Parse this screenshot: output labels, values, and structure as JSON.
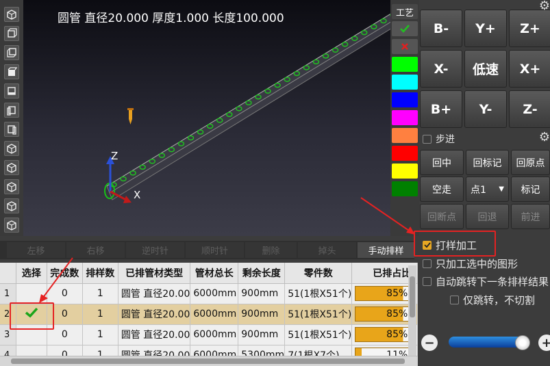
{
  "viewport": {
    "title": "圆管 直径20.000 厚度1.000 长度100.000",
    "axis_z": "Z",
    "axis_x": "X"
  },
  "craft": {
    "label": "工艺",
    "check_icon": "check-icon",
    "cross_icon": "cross-icon",
    "colors": [
      "#00ff00",
      "#00ffff",
      "#0000ff",
      "#ff00ff",
      "#ff8040",
      "#ff0000",
      "#ffff00",
      "#008000"
    ]
  },
  "dirpad": {
    "b_minus": "B-",
    "y_plus": "Y+",
    "z_plus": "Z+",
    "x_minus": "X-",
    "low_speed": "低速",
    "x_plus": "X+",
    "b_plus": "B+",
    "y_minus": "Y-",
    "z_minus": "Z-"
  },
  "step": {
    "label": "步进"
  },
  "actions": {
    "center": "回中",
    "return_mark": "回标记",
    "return_origin": "回原点",
    "dry_run": "空走",
    "point_select": "点1",
    "mark": "标记",
    "return_break": "回断点",
    "back": "回退",
    "forward": "前进"
  },
  "options": {
    "proof": "打样加工",
    "only_selected": "只加工选中的图形",
    "auto_jump": "自动跳转下一条排样结果",
    "jump_only": "仅跳转，不切割"
  },
  "tabs": [
    "左移",
    "右移",
    "逆时针",
    "顺时针",
    "删除",
    "掉头",
    "手动排样"
  ],
  "table": {
    "headers": [
      "选择",
      "完成数",
      "排样数",
      "已排管材类型",
      "管材总长",
      "剩余长度",
      "零件数",
      "已排占比"
    ],
    "rows": [
      {
        "idx": "1",
        "done": "0",
        "count": "1",
        "type": "圆管 直径20.00",
        "total": "6000mm",
        "remain": "900mm",
        "parts": "51(1根X51个)",
        "ratio": "85%"
      },
      {
        "idx": "2",
        "done": "0",
        "count": "1",
        "type": "圆管 直径20.00",
        "total": "6000mm",
        "remain": "900mm",
        "parts": "51(1根X51个)",
        "ratio": "85%"
      },
      {
        "idx": "3",
        "done": "0",
        "count": "1",
        "type": "圆管 直径20.00",
        "total": "6000mm",
        "remain": "900mm",
        "parts": "51(1根X51个)",
        "ratio": "85%"
      },
      {
        "idx": "4",
        "done": "0",
        "count": "1",
        "type": "圆管 直径20.00",
        "total": "6000mm",
        "remain": "5300mm",
        "parts": "7(1根X7个)",
        "ratio": "11%"
      }
    ]
  },
  "progress": {
    "row1": 0.85,
    "row2": 0.85,
    "row3": 0.85,
    "row4": 0.11
  },
  "slider": {
    "level": 0.9
  },
  "accent_color": "#e7a723",
  "annotation_color": "#e52222"
}
